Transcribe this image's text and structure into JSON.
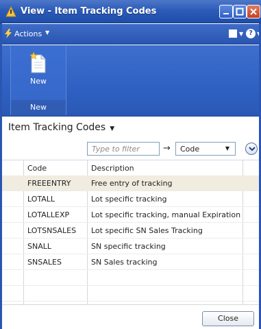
{
  "window": {
    "title": "View - Item Tracking Codes"
  },
  "actions_bar": {
    "actions_label": "Actions",
    "help_label": "?"
  },
  "ribbon": {
    "new_label": "New",
    "group_label": "New"
  },
  "page": {
    "heading": "Item Tracking Codes"
  },
  "filter": {
    "placeholder": "Type to filter",
    "field": "Code"
  },
  "table": {
    "columns": [
      "Code",
      "Description"
    ],
    "rows": [
      {
        "code": "FREEENTRY",
        "description": "Free entry of tracking"
      },
      {
        "code": "LOTALL",
        "description": "Lot specific tracking"
      },
      {
        "code": "LOTALLEXP",
        "description": "Lot specific tracking, manual Expiration"
      },
      {
        "code": "LOTSNSALES",
        "description": "Lot specific SN Sales Tracking"
      },
      {
        "code": "SNALL",
        "description": "SN specific tracking"
      },
      {
        "code": "SNSALES",
        "description": "SN Sales tracking"
      }
    ]
  },
  "footer": {
    "close_label": "Close"
  },
  "colors": {
    "titlebar": "#2c5bb8",
    "ribbon": "#3566c8",
    "selected_row": "#f1ece0"
  }
}
